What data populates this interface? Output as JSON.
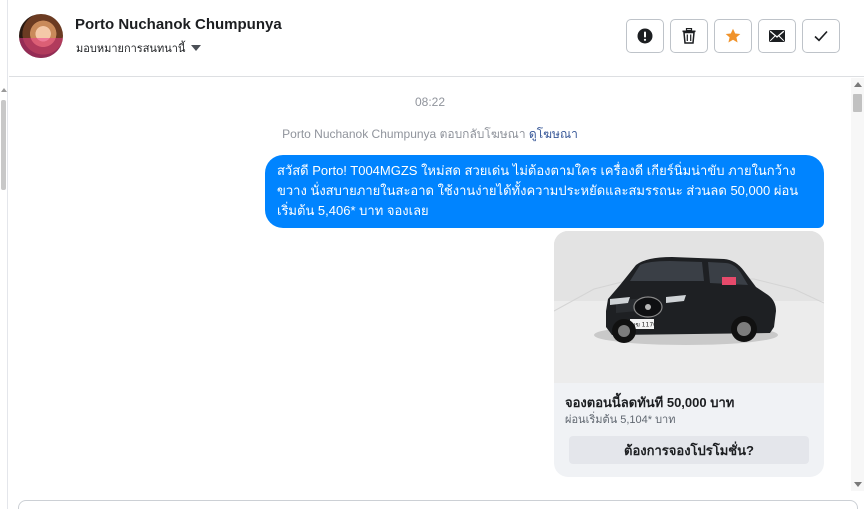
{
  "header": {
    "contact_name": "Porto Nuchanok Chumpunya",
    "assign_label": "มอบหมายการสนทนานี้",
    "actions": [
      {
        "icon": "alert-icon",
        "color": "#1c1e21"
      },
      {
        "icon": "trash-icon",
        "color": "#1c1e21"
      },
      {
        "icon": "star-icon",
        "color": "#f0932b"
      },
      {
        "icon": "mail-icon",
        "color": "#1c1e21"
      },
      {
        "icon": "check-icon",
        "color": "#1c1e21"
      }
    ]
  },
  "conversation": {
    "timestamp": "08:22",
    "ad_reply_prefix": "Porto Nuchanok Chumpunya ตอบกลับโฆษณา",
    "ad_reply_link": "ดูโฆษณา",
    "message_text": "สวัสดี Porto! T004MGZS ใหม่สด สวยเด่น ไม่ต้องตามใคร เครื่องดี เกียร์นิ่มน่าขับ ภายในกว้างขวาง นั่งสบายภายในสะอาด ใช้งานง่ายได้ทั้งความประหยัดและสมรรถนะ ส่วนลด 50,000 ผ่อนเริ่มต้น 5,406* บาท จองเลย",
    "bubble_color": "#0084ff"
  },
  "ad_card": {
    "image_alt": "black SUV car photo",
    "title": "จองตอนนี้ลดทันที  50,000 บาท",
    "subtitle": "ผ่อนเริ่มต้น 5,104* บาท",
    "button_label": "ต้องการจองโปรโมชั่น?"
  }
}
